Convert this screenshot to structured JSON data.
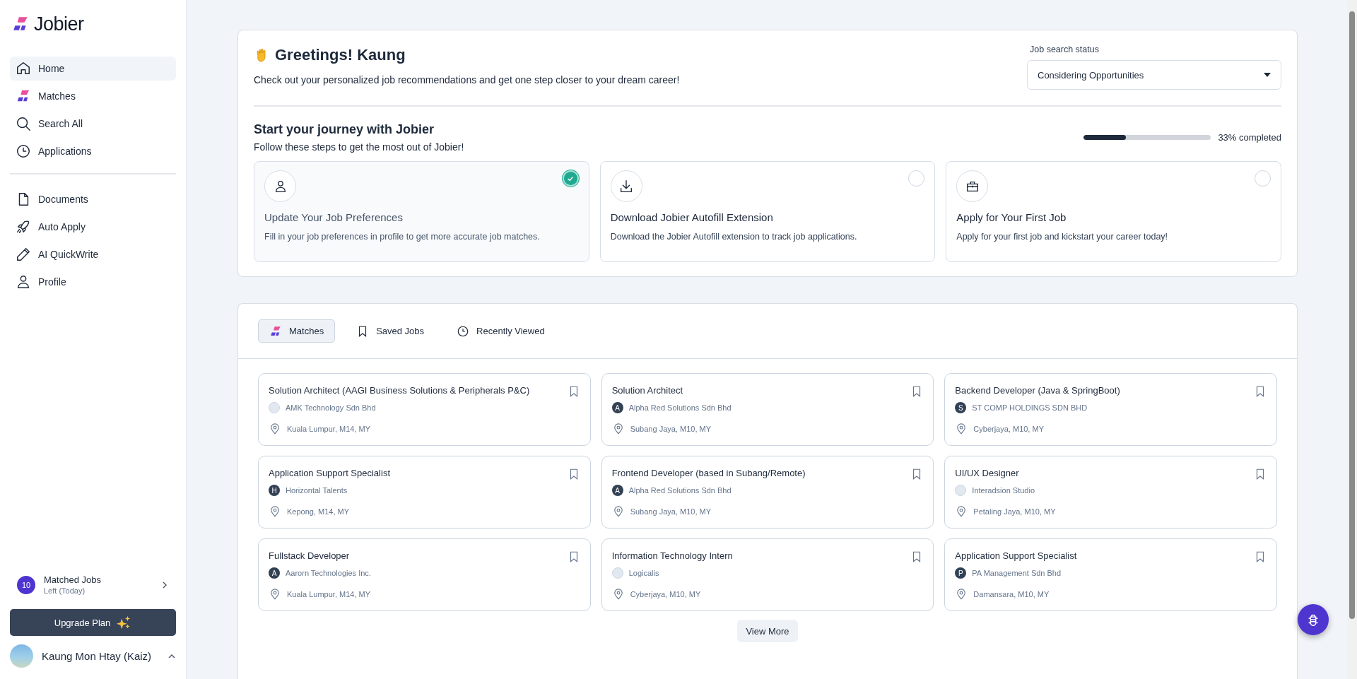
{
  "brand": {
    "name": "Jobier"
  },
  "sidebar": {
    "groups": [
      [
        {
          "label": "Home",
          "selected": true
        },
        {
          "label": "Matches",
          "selected": false
        },
        {
          "label": "Search All",
          "selected": false
        },
        {
          "label": "Applications",
          "selected": false
        }
      ],
      [
        {
          "label": "Documents",
          "selected": false
        },
        {
          "label": "Auto Apply",
          "selected": false
        },
        {
          "label": "AI QuickWrite",
          "selected": false
        },
        {
          "label": "Profile",
          "selected": false
        }
      ]
    ],
    "matched_jobs": {
      "count": "10",
      "title": "Matched Jobs",
      "subtitle": "Left (Today)"
    },
    "upgrade_button": "Upgrade Plan",
    "user": {
      "name": "Kaung Mon Htay (Kaiz)"
    }
  },
  "greeting": {
    "title": "Greetings! Kaung",
    "subtitle": "Check out your personalized job recommendations and get one step closer to your dream career!"
  },
  "job_search_status": {
    "label": "Job search status",
    "value": "Considering Opportunities"
  },
  "journey": {
    "title": "Start your journey with Jobier",
    "subtitle": "Follow these steps to get the most out of Jobier!",
    "level": 0.33,
    "progress_text": "33% completed",
    "steps": [
      {
        "title": "Update Your Job Preferences",
        "description": "Fill in your job preferences in profile to get more accurate job matches.",
        "done": true
      },
      {
        "title": "Download Jobier Autofill Extension",
        "description": "Download the Jobier Autofill extension to track job applications.",
        "done": false
      },
      {
        "title": "Apply for Your First Job",
        "description": "Apply for your first job and kickstart your career today!",
        "done": false
      }
    ]
  },
  "tabs": [
    {
      "label": "Matches",
      "selected": true
    },
    {
      "label": "Saved Jobs",
      "selected": false
    },
    {
      "label": "Recently Viewed",
      "selected": false
    }
  ],
  "jobs": [
    {
      "title": "Solution Architect (AAGI Business Solutions & Peripherals P&C)",
      "company": "AMK Technology Sdn Bhd",
      "logo": {
        "kind": "image"
      },
      "location": "Kuala Lumpur, M14, MY"
    },
    {
      "title": "Solution Architect",
      "company": "Alpha Red Solutions Sdn Bhd",
      "logo": {
        "kind": "letter",
        "text": "A"
      },
      "location": "Subang Jaya, M10, MY"
    },
    {
      "title": "Backend Developer (Java & SpringBoot)",
      "company": "ST COMP HOLDINGS SDN BHD",
      "logo": {
        "kind": "letter",
        "text": "S"
      },
      "location": "Cyberjaya, M10, MY"
    },
    {
      "title": "Application Support Specialist",
      "company": "Horizontal Talents",
      "logo": {
        "kind": "letter",
        "text": "H"
      },
      "location": "Kepong, M14, MY"
    },
    {
      "title": "Frontend Developer (based in Subang/Remote)",
      "company": "Alpha Red Solutions Sdn Bhd",
      "logo": {
        "kind": "letter",
        "text": "A"
      },
      "location": "Subang Jaya, M10, MY"
    },
    {
      "title": "UI/UX Designer",
      "company": "Interadsion Studio",
      "logo": {
        "kind": "image"
      },
      "location": "Petaling Jaya, M10, MY"
    },
    {
      "title": "Fullstack Developer",
      "company": "Aarorn Technologies Inc.",
      "logo": {
        "kind": "letter",
        "text": "A"
      },
      "location": "Kuala Lumpur, M14, MY"
    },
    {
      "title": "Information Technology Intern",
      "company": "Logicalis",
      "logo": {
        "kind": "image"
      },
      "location": "Cyberjaya, M10, MY"
    },
    {
      "title": "Application Support Specialist",
      "company": "PA Management Sdn Bhd",
      "logo": {
        "kind": "letter",
        "text": "P"
      },
      "location": "Damansara, M10, MY"
    }
  ],
  "view_more": "View More"
}
